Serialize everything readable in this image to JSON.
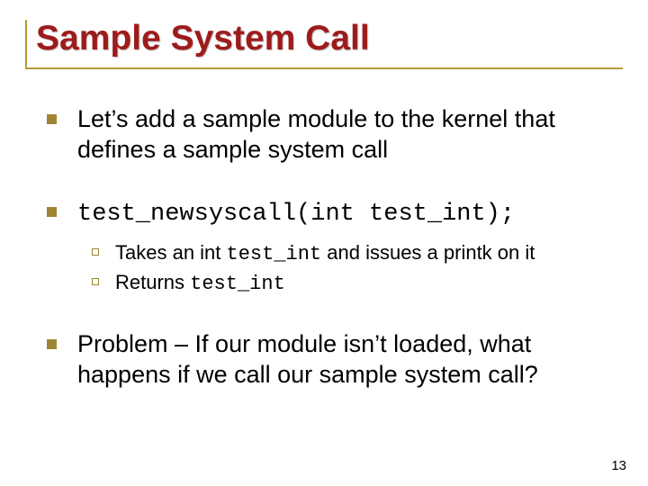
{
  "title": "Sample System Call",
  "items": [
    {
      "text": "Let’s add a sample module to the kernel that defines a sample system call",
      "mono": false,
      "sub": []
    },
    {
      "text": "test_newsyscall(int test_int);",
      "mono": true,
      "sub": [
        {
          "pre": "Takes an int ",
          "code": "test_int",
          "post": " and issues a printk on it"
        },
        {
          "pre": "Returns ",
          "code": "test_int",
          "post": ""
        }
      ]
    },
    {
      "text": "Problem – If our module isn’t loaded, what happens if we call our sample system call?",
      "mono": false,
      "sub": []
    }
  ],
  "page_number": "13"
}
